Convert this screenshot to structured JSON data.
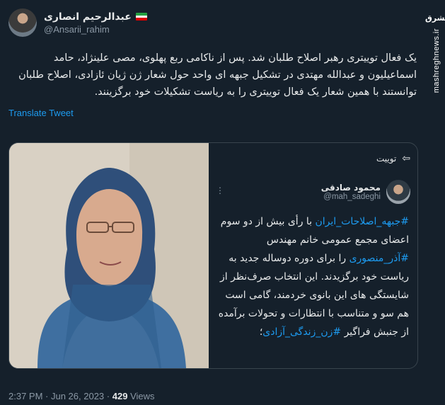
{
  "author": {
    "display_name": "عبدالرحیم انصاری",
    "handle": "@Ansarii_rahim",
    "flag": "iran-flag"
  },
  "tweet_text": "یک فعال توییتری رهبر اصلاح طلبان شد. پس از ناکامی ربع پهلوی، مصی علینژاد، حامد اسماعیلیون و عبدالله مهتدی در تشکیل جبهه ای واحد حول شعار ژن ژیان ئازادی، اصلاح طلبان توانستند با همین شعار یک فعال توییتری را به ریاست تشکیلات خود برگزینند.",
  "translate_label": "Translate Tweet",
  "quote": {
    "label": "توییت",
    "author_name": "محمود صادقی",
    "author_handle": "@mah_sadeghi",
    "text_parts": [
      {
        "type": "hashtag",
        "text": "#جبهه_اصلاحات_ایران"
      },
      {
        "type": "text",
        "text": " با رأی بیش از دو سوم اعضای مجمع عمومی خانم مهندس "
      },
      {
        "type": "hashtag",
        "text": "#آذر_منصوری"
      },
      {
        "type": "text",
        "text": " را برای دوره دوساله جدید به ریاست خود برگزیدند. این انتخاب صرف‌نظر از شایستگی های این بانوی خردمند، گامی است هم سو و متناسب با انتظارات و تحولات برآمده از جنبش فراگیر "
      },
      {
        "type": "hashtag",
        "text": "#زن_زندگی_آزادی"
      },
      {
        "type": "text",
        "text": "؛"
      }
    ]
  },
  "meta": {
    "time": "2:37 PM",
    "date": "Jun 26, 2023",
    "views_count": "429",
    "views_label": "Views"
  },
  "watermark": {
    "logo": "مشرق",
    "site": "mashreghnews.ir"
  },
  "colors": {
    "background": "#15202b",
    "link": "#1d9bf0",
    "secondary_text": "#8b98a5"
  }
}
